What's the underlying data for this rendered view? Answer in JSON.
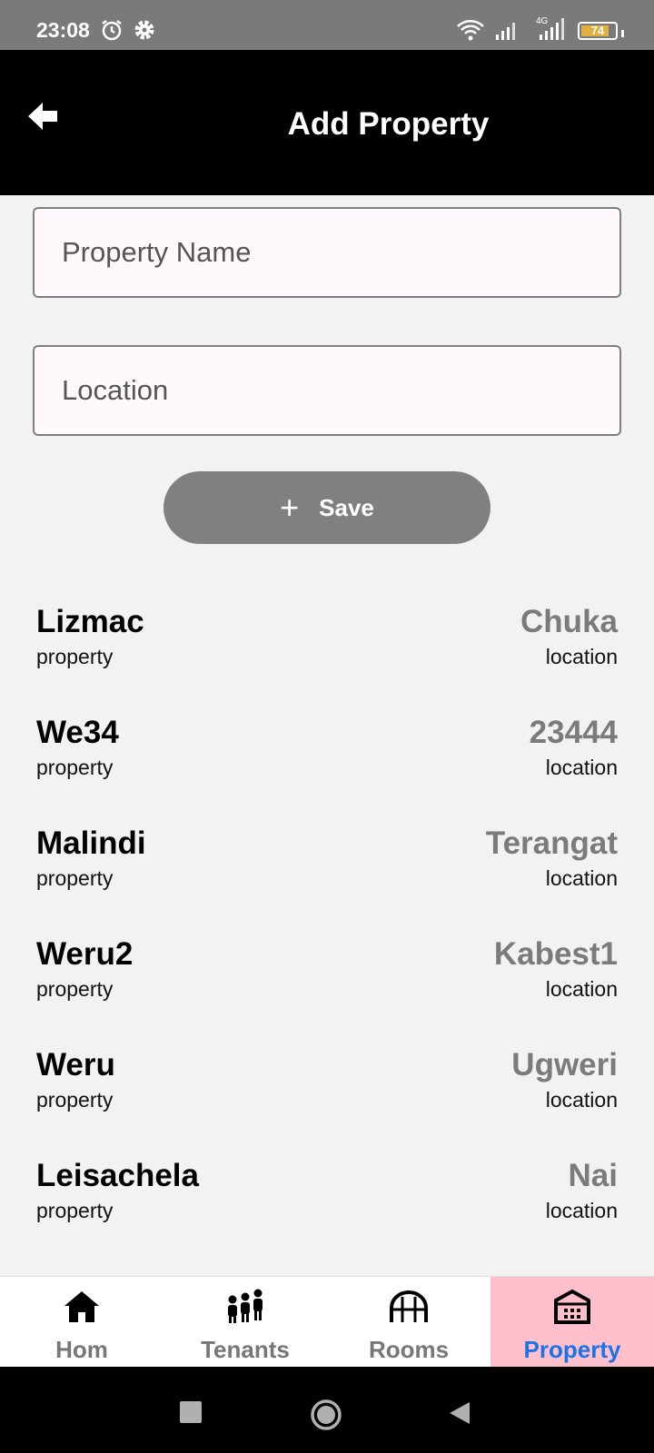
{
  "status_bar": {
    "time": "23:08",
    "battery": "74",
    "network": "4G",
    "icons": [
      "alarm-icon",
      "settings-icon",
      "wifi-icon",
      "signal-icon",
      "battery-icon"
    ]
  },
  "header": {
    "title": "Add Property",
    "back_icon": "back-arrow-icon"
  },
  "form": {
    "property_name_placeholder": "Property Name",
    "property_name_value": "",
    "location_placeholder": "Location",
    "location_value": "",
    "save_label": "Save",
    "save_icon": "plus-icon"
  },
  "properties": [
    {
      "name": "Lizmac",
      "name_caption": "property",
      "location": "Chuka",
      "location_caption": "location"
    },
    {
      "name": "We34",
      "name_caption": "property",
      "location": "23444",
      "location_caption": "location"
    },
    {
      "name": "Malindi",
      "name_caption": "property",
      "location": "Terangat",
      "location_caption": "location"
    },
    {
      "name": "Weru2",
      "name_caption": "property",
      "location": "Kabest1",
      "location_caption": "location"
    },
    {
      "name": "Weru",
      "name_caption": "property",
      "location": "Ugweri",
      "location_caption": "location"
    },
    {
      "name": "Leisachela",
      "name_caption": "property",
      "location": "Nai",
      "location_caption": "location"
    }
  ],
  "bottom_nav": {
    "active_index": 3,
    "items": [
      {
        "label": "Hom",
        "icon": "home-icon"
      },
      {
        "label": "Tenants",
        "icon": "people-icon"
      },
      {
        "label": "Rooms",
        "icon": "rooms-icon"
      },
      {
        "label": "Property",
        "icon": "building-icon"
      }
    ]
  },
  "colors": {
    "app_bar": "#000000",
    "status_bar": "#7a7a7a",
    "save_button": "#808080",
    "active_nav_bg": "#ffc0cb",
    "active_nav_text": "#1a73e8",
    "location_text": "#7b7b7b"
  }
}
